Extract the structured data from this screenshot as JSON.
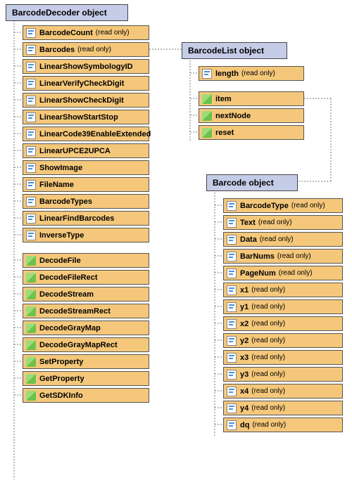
{
  "colors": {
    "header_bg": "#c5cce8",
    "row_bg": "#f4c77a"
  },
  "readonly_label": "(read only)",
  "decoder": {
    "title": "BarcodeDecoder object",
    "props": [
      {
        "name": "BarcodeCount",
        "readonly": true
      },
      {
        "name": "Barcodes",
        "readonly": true
      },
      {
        "name": "LinearShowSymbologyID"
      },
      {
        "name": "LinearVerifyCheckDigit"
      },
      {
        "name": "LinearShowCheckDigit"
      },
      {
        "name": "LinearShowStartStop"
      },
      {
        "name": "LinearCode39EnableExtended"
      },
      {
        "name": "LinearUPCE2UPCA"
      },
      {
        "name": "ShowImage"
      },
      {
        "name": "FileName"
      },
      {
        "name": "BarcodeTypes"
      },
      {
        "name": "LinearFindBarcodes"
      },
      {
        "name": "InverseType"
      }
    ],
    "methods": [
      {
        "name": "DecodeFile"
      },
      {
        "name": "DecodeFileRect"
      },
      {
        "name": "DecodeStream"
      },
      {
        "name": "DecodeStreamRect"
      },
      {
        "name": "DecodeGrayMap"
      },
      {
        "name": "DecodeGrayMapRect"
      },
      {
        "name": "SetProperty"
      },
      {
        "name": "GetProperty"
      },
      {
        "name": "GetSDKInfo"
      }
    ]
  },
  "list": {
    "title": "BarcodeList object",
    "props": [
      {
        "name": "length",
        "readonly": true
      }
    ],
    "methods": [
      {
        "name": "item"
      },
      {
        "name": "nextNode"
      },
      {
        "name": "reset"
      }
    ]
  },
  "barcode": {
    "title": "Barcode object",
    "props": [
      {
        "name": "BarcodeType",
        "readonly": true
      },
      {
        "name": "Text",
        "readonly": true
      },
      {
        "name": "Data",
        "readonly": true
      },
      {
        "name": "BarNums",
        "readonly": true
      },
      {
        "name": "PageNum",
        "readonly": true
      },
      {
        "name": "x1",
        "readonly": true
      },
      {
        "name": "y1",
        "readonly": true
      },
      {
        "name": "x2",
        "readonly": true
      },
      {
        "name": "y2",
        "readonly": true
      },
      {
        "name": "x3",
        "readonly": true
      },
      {
        "name": "y3",
        "readonly": true
      },
      {
        "name": "x4",
        "readonly": true
      },
      {
        "name": "y4",
        "readonly": true
      },
      {
        "name": "dq",
        "readonly": true
      }
    ]
  }
}
